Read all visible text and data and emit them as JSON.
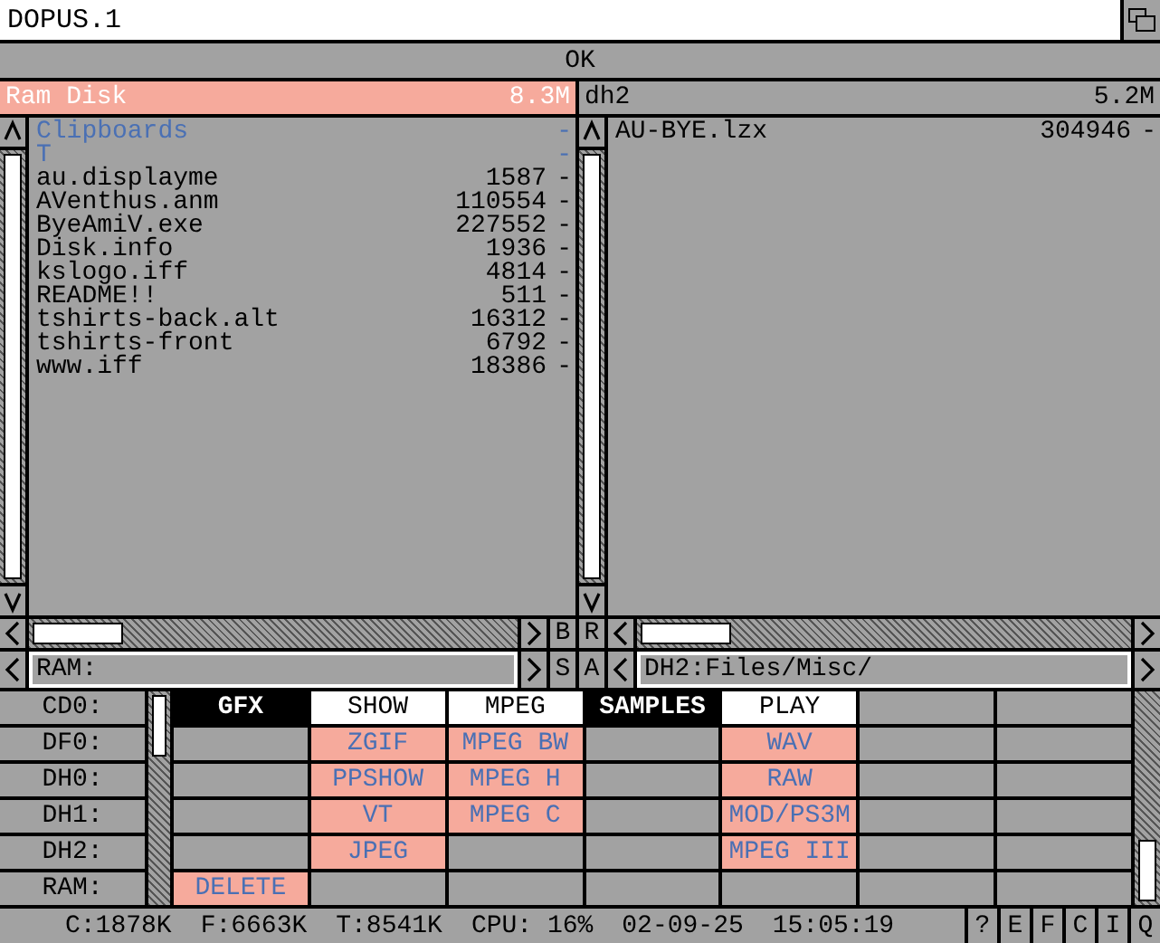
{
  "window": {
    "title": "DOPUS.1"
  },
  "message_bar": {
    "text": "OK"
  },
  "panels": [
    {
      "name": "Ram Disk",
      "free": "8.3M",
      "selected": true,
      "path": "RAM:",
      "side_buttons": [
        "B",
        "S"
      ],
      "entries": [
        {
          "kind": "dir",
          "name": "Clipboards",
          "flag": "-"
        },
        {
          "kind": "dir",
          "name": "T",
          "flag": "-"
        },
        {
          "kind": "file",
          "name": "au.displayme",
          "size": "1587",
          "flag": "-"
        },
        {
          "kind": "file",
          "name": "AVenthus.anm",
          "size": "110554",
          "flag": "-"
        },
        {
          "kind": "file",
          "name": "ByeAmiV.exe",
          "size": "227552",
          "flag": "-"
        },
        {
          "kind": "file",
          "name": "Disk.info",
          "size": "1936",
          "flag": "-"
        },
        {
          "kind": "file",
          "name": "kslogo.iff",
          "size": "4814",
          "flag": "-"
        },
        {
          "kind": "file",
          "name": "README!!",
          "size": "511",
          "flag": "-"
        },
        {
          "kind": "file",
          "name": "tshirts-back.alt",
          "size": "16312",
          "flag": "-"
        },
        {
          "kind": "file",
          "name": "tshirts-front",
          "size": "6792",
          "flag": "-"
        },
        {
          "kind": "file",
          "name": "www.iff",
          "size": "18386",
          "flag": "-"
        }
      ]
    },
    {
      "name": "dh2",
      "free": "5.2M",
      "selected": false,
      "path": "DH2:Files/Misc/",
      "side_buttons": [
        "R",
        "A"
      ],
      "entries": [
        {
          "kind": "file",
          "name": "AU-BYE.lzx",
          "size": "304946",
          "flag": "-"
        }
      ]
    }
  ],
  "devices": [
    "CD0:",
    "DF0:",
    "DH0:",
    "DH1:",
    "DH2:",
    "RAM:"
  ],
  "button_banks": [
    {
      "header": {
        "kind": "inverse",
        "label": "GFX"
      },
      "cells": [
        {
          "kind": "blank"
        },
        {
          "kind": "blank"
        },
        {
          "kind": "blank"
        },
        {
          "kind": "blank"
        },
        {
          "kind": "function",
          "label": "DELETE"
        }
      ]
    },
    {
      "header": {
        "kind": "normal",
        "label": "SHOW"
      },
      "cells": [
        {
          "kind": "function",
          "label": "ZGIF"
        },
        {
          "kind": "function",
          "label": "PPSHOW"
        },
        {
          "kind": "function",
          "label": "VT"
        },
        {
          "kind": "function",
          "label": "JPEG"
        },
        {
          "kind": "blank"
        }
      ]
    },
    {
      "header": {
        "kind": "normal",
        "label": "MPEG"
      },
      "cells": [
        {
          "kind": "function",
          "label": "MPEG BW"
        },
        {
          "kind": "function",
          "label": "MPEG H"
        },
        {
          "kind": "function",
          "label": "MPEG C"
        },
        {
          "kind": "blank"
        },
        {
          "kind": "blank"
        }
      ]
    },
    {
      "header": {
        "kind": "inverse",
        "label": "SAMPLES"
      },
      "cells": [
        {
          "kind": "blank"
        },
        {
          "kind": "blank"
        },
        {
          "kind": "blank"
        },
        {
          "kind": "blank"
        },
        {
          "kind": "blank"
        }
      ]
    },
    {
      "header": {
        "kind": "normal",
        "label": "PLAY"
      },
      "cells": [
        {
          "kind": "function",
          "label": "WAV"
        },
        {
          "kind": "function",
          "label": "RAW"
        },
        {
          "kind": "function",
          "label": "MOD/PS3M"
        },
        {
          "kind": "function",
          "label": "MPEG III"
        },
        {
          "kind": "blank"
        }
      ]
    },
    {
      "header": {
        "kind": "blank"
      },
      "cells": [
        {
          "kind": "blank"
        },
        {
          "kind": "blank"
        },
        {
          "kind": "blank"
        },
        {
          "kind": "blank"
        },
        {
          "kind": "blank"
        }
      ]
    },
    {
      "header": {
        "kind": "blank"
      },
      "cells": [
        {
          "kind": "blank"
        },
        {
          "kind": "blank"
        },
        {
          "kind": "blank"
        },
        {
          "kind": "blank"
        },
        {
          "kind": "blank"
        }
      ]
    }
  ],
  "status_bar": {
    "items": [
      "C:1878K",
      "F:6663K",
      "T:8541K",
      "CPU: 16%",
      "02-09-25",
      "15:05:19"
    ],
    "buttons": [
      "?",
      "E",
      "F",
      "C",
      "I",
      "Q"
    ]
  }
}
